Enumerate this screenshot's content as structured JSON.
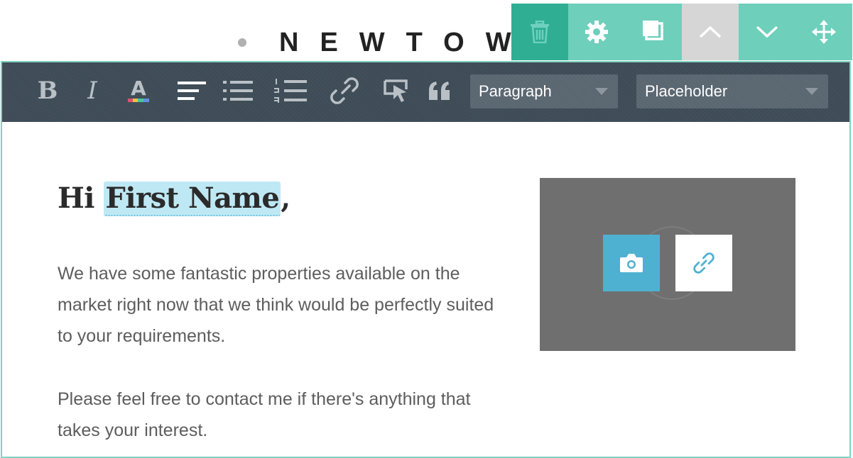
{
  "brand": {
    "text": "NEWTOW"
  },
  "block_actions": {
    "icons": [
      "trash-icon",
      "gear-icon",
      "duplicate-icon",
      "chevron-up-icon",
      "chevron-down-icon",
      "move-icon"
    ],
    "colors": {
      "delete": "#2fae94",
      "default": "#6ecfbb",
      "disabled": "#d6d6d6"
    }
  },
  "toolbar": {
    "bold_label": "B",
    "italic_label": "I",
    "font_color_label": "A",
    "icons": [
      "text-color-icon",
      "align-left-icon",
      "bullet-list-icon",
      "numbered-list-icon",
      "link-icon",
      "button-link-icon",
      "quote-icon"
    ],
    "paragraph_select": {
      "value": "Paragraph"
    },
    "placeholder_select": {
      "value": "Placeholder"
    }
  },
  "content": {
    "greeting_prefix": "Hi ",
    "greeting_placeholder": "First Name",
    "greeting_suffix": ",",
    "paragraph_1": "We have some fantastic properties available on the market right now that we think would be perfectly suited to your requirements.",
    "paragraph_2": "Please feel free to contact me if there's anything that takes your interest."
  },
  "image_block": {
    "icons": [
      "camera-icon",
      "link-icon"
    ],
    "colors": {
      "upload": "#4fb1d1",
      "link_bg": "#ffffff"
    }
  },
  "colors": {
    "frame_border": "#7fd3c2",
    "format_bar": "#3e4c57",
    "placeholder_highlight": "#bfe8f5"
  }
}
